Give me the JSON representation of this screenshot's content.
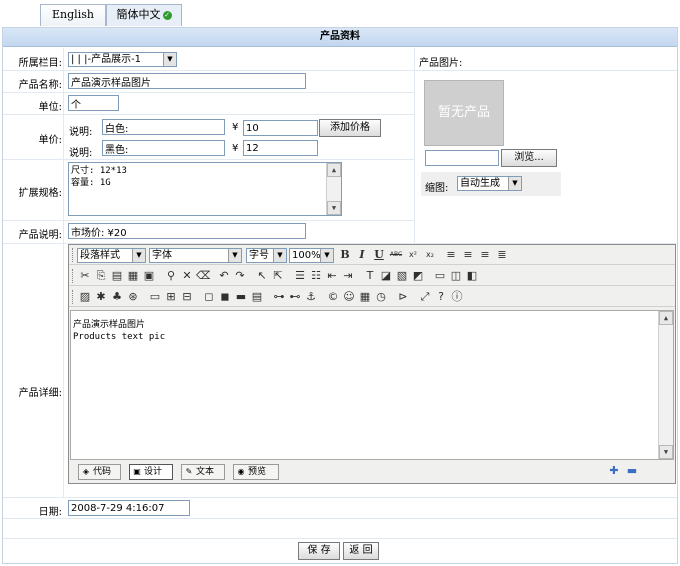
{
  "tabs": [
    {
      "label": "English"
    },
    {
      "label": "簡体中文",
      "active": true
    }
  ],
  "title": "产品资料",
  "fields": {
    "category": {
      "label": "所属栏目:",
      "value": "| | |-产品展示-1"
    },
    "name": {
      "label": "产品名称:",
      "value": "产品演示样品图片"
    },
    "unit": {
      "label": "单位:",
      "value": "个"
    },
    "price": {
      "label": "单价:",
      "rows": [
        {
          "desc_label": "说明:",
          "desc_value": "白色:",
          "currency": "¥",
          "price": "10"
        },
        {
          "desc_label": "说明:",
          "desc_value": "黑色:",
          "currency": "¥",
          "price": "12"
        }
      ],
      "add_button": "添加价格"
    },
    "spec": {
      "label": "扩展规格:",
      "value": "尺寸: 12*13\n容量: 1G"
    },
    "note": {
      "label": "产品说明:",
      "value": "市场价: ¥20"
    },
    "detail": {
      "label": "产品详细:"
    },
    "date": {
      "label": "日期:",
      "value": "2008-7-29 4:16:07"
    }
  },
  "image_panel": {
    "label": "产品图片:",
    "placeholder": "暂无产品",
    "browse_button": "浏览...",
    "thumb_label": "缩图:",
    "thumb_value": "自动生成"
  },
  "editor": {
    "dropdowns": {
      "paragraph": "段落样式",
      "font": "字体",
      "size": "字号",
      "zoom": "100%"
    },
    "content_lines": [
      "产品演示样品图片",
      "Products text pic"
    ],
    "mode_tabs": [
      "代码",
      "设计",
      "文本",
      "预览"
    ],
    "active_mode": "设计",
    "format_labels": {
      "bold": "B",
      "italic": "I",
      "underline": "U",
      "strike": "ABC",
      "superscript": "x²",
      "subscript": "x₂"
    }
  },
  "actions": {
    "save": "保 存",
    "back": "返 回"
  }
}
